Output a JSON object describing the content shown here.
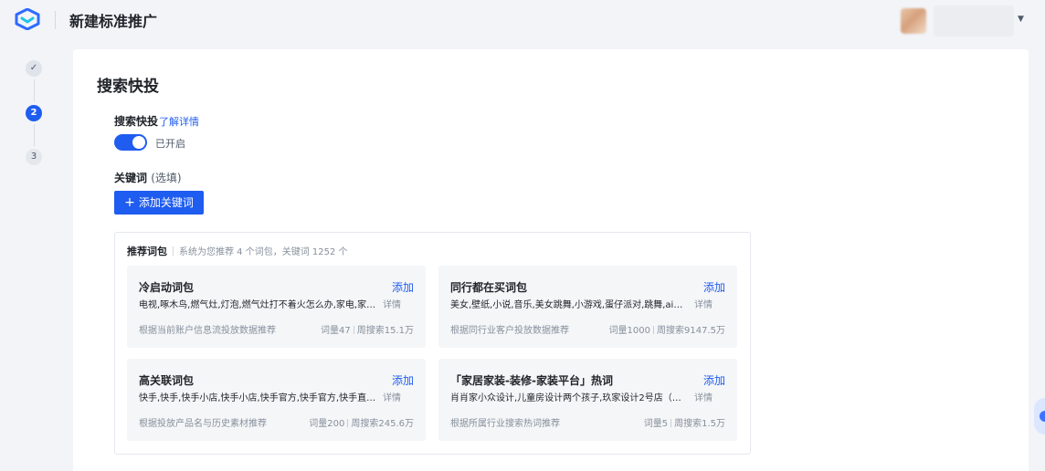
{
  "header": {
    "logo_icon": "brand-logo-icon",
    "title": "新建标准推广",
    "user_caret_icon": "caret-down-icon"
  },
  "steps": [
    {
      "label": "",
      "state": "done",
      "icon": "check-icon"
    },
    {
      "label": "2",
      "state": "active"
    },
    {
      "label": "3",
      "state": "todo"
    }
  ],
  "section": {
    "title": "搜索快投",
    "search_label": "搜索快投",
    "learn_more": "了解详情",
    "toggle_on": true,
    "toggle_text": "已开启",
    "keyword_label": "关键词",
    "keyword_optional": "(选填)",
    "add_keyword_button": "添加关键词"
  },
  "recommend": {
    "title": "推荐词包",
    "subtitle": "系统为您推荐 4 个词包，关键词 1252 个",
    "cards": [
      {
        "title": "冷启动词包",
        "add": "添加",
        "words": "电视,啄木鸟,燃气灶,灯泡,燃气灶打不着火怎么办,家电,家电...",
        "detail": "详情",
        "source": "根据当前账户信息流投放数据推荐",
        "count": "词量47",
        "weekly": "周搜索15.1万"
      },
      {
        "title": "同行都在买词包",
        "add": "添加",
        "words": "美女,壁纸,小说,音乐,美女跳舞,小游戏,蛋仔派对,跳舞,ai智能...",
        "detail": "详情",
        "source": "根据同行业客户投放数据推荐",
        "count": "词量1000",
        "weekly": "周搜索9147.5万"
      },
      {
        "title": "高关联词包",
        "add": "添加",
        "words": "快手,快手,快手小店,快手小店,快手官方,快手官方,快手直播,...",
        "detail": "详情",
        "source": "根据投放产品名与历史素材推荐",
        "count": "词量200",
        "weekly": "周搜索245.6万"
      },
      {
        "title": "「家居家装-装修-家装平台」热词",
        "add": "添加",
        "words": "肖肖家小众设计,儿童房设计两个孩子,玖家设计2号店（高老...",
        "detail": "详情",
        "source": "根据所属行业搜索热词推荐",
        "count": "词量5",
        "weekly": "周搜索1.5万"
      }
    ]
  },
  "colors": {
    "primary": "#1f5cf0",
    "page_bg": "#f2f4f8",
    "card_bg": "#f5f6f8",
    "muted_text": "#86909c"
  }
}
